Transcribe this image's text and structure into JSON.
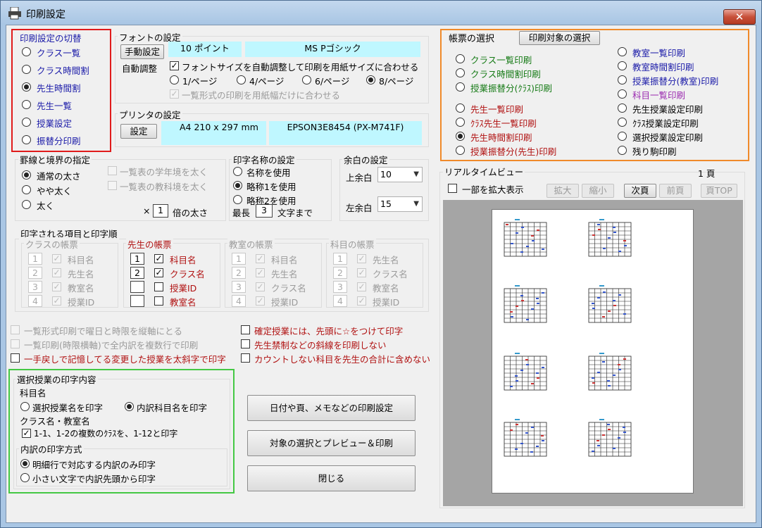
{
  "window": {
    "title": "印刷設定",
    "close": "✕"
  },
  "switch": {
    "title": "印刷設定の切替",
    "items": [
      "クラス一覧",
      "クラス時間割",
      "先生時間割",
      "先生一覧",
      "授業設定",
      "振替分印刷"
    ],
    "selected": 2
  },
  "font": {
    "title": "フォントの設定",
    "manual_button": "手動設定",
    "size": "10 ポイント",
    "name": "MS Pゴシック",
    "auto_label": "自動調整",
    "auto_check": "フォントサイズを自動調整して印刷を用紙サイズに合わせる",
    "pages": [
      "1/ページ",
      "4/ページ",
      "6/ページ",
      "8/ページ"
    ],
    "pages_selected": 3,
    "fit_width": "一覧形式の印刷を用紙幅だけに合わせる"
  },
  "printer": {
    "title": "プリンタの設定",
    "button": "設定",
    "paper": "A4 210 x 297 mm",
    "printer_name": "EPSON3E8454 (PX-M741F)"
  },
  "lines": {
    "title": "罫線と境界の指定",
    "options": [
      "通常の太さ",
      "やや太く",
      "太く"
    ],
    "selected": 0,
    "check1": "一覧表の学年境を太く",
    "check2": "一覧表の教科境を太く",
    "times_label": "×",
    "times_value": "1",
    "times_suffix": "倍の太さ"
  },
  "names": {
    "title": "印字名称の設定",
    "options": [
      "名称を使用",
      "略称1を使用",
      "略称2を使用"
    ],
    "selected": 1,
    "max_label": "最長",
    "max_value": "3",
    "max_suffix": "文字まで"
  },
  "margin": {
    "title": "余白の設定",
    "top_label": "上余白",
    "top_value": "10",
    "left_label": "左余白",
    "left_value": "15"
  },
  "items": {
    "title": "印字される項目と印字順",
    "class": {
      "title": "クラスの帳票",
      "rows": [
        {
          "n": "1",
          "label": "科目名"
        },
        {
          "n": "2",
          "label": "先生名"
        },
        {
          "n": "3",
          "label": "教室名"
        },
        {
          "n": "4",
          "label": "授業ID"
        }
      ]
    },
    "teacher": {
      "title": "先生の帳票",
      "rows": [
        {
          "n": "1",
          "label": "科目名"
        },
        {
          "n": "2",
          "label": "クラス名"
        },
        {
          "n": "",
          "label": "授業ID"
        },
        {
          "n": "",
          "label": "教室名"
        }
      ]
    },
    "room": {
      "title": "教室の帳票",
      "rows": [
        {
          "n": "1",
          "label": "科目名"
        },
        {
          "n": "2",
          "label": "先生名"
        },
        {
          "n": "3",
          "label": "クラス名"
        },
        {
          "n": "4",
          "label": "授業ID"
        }
      ]
    },
    "subject": {
      "title": "科目の帳票",
      "rows": [
        {
          "n": "1",
          "label": "先生名"
        },
        {
          "n": "2",
          "label": "クラス名"
        },
        {
          "n": "3",
          "label": "教室名"
        },
        {
          "n": "4",
          "label": "授業ID"
        }
      ]
    }
  },
  "opts_left": [
    "一覧形式印刷で曜日と時限を縦軸にとる",
    "一覧印刷(時限横軸)で全内訳を複数行で印刷",
    "一手戻しで記憶してる変更した授業を太斜字で印字"
  ],
  "opts_right": [
    "確定授業には、先頭に☆をつけて印字",
    "先生禁制などの斜線を印刷しない",
    "カウントしない科目を先生の合計に含めない"
  ],
  "selected_print": {
    "title": "選択授業の印字内容",
    "subject_label": "科目名",
    "opt1": "選択授業名を印字",
    "opt2": "内訳科目名を印字",
    "class_label": "クラス名・教室名",
    "class_check": "1-1、1-2の複数のｸﾗｽを、1-12と印字",
    "method_title": "内訳の印字方式",
    "m1": "明細行で対応する内訳のみ印字",
    "m2": "小さい文字で内訳先頭から印字"
  },
  "buttons": {
    "date": "日付や頁、メモなどの印刷設定",
    "preview": "対象の選択とプレビュー＆印刷",
    "close": "閉じる"
  },
  "report": {
    "title": "帳票の選択",
    "target_button": "印刷対象の選択",
    "left": [
      {
        "label": "クラス一覧印刷",
        "color": "green"
      },
      {
        "label": "クラス時間割印刷",
        "color": "green"
      },
      {
        "label": "授業振替分(ｸﾗｽ)印刷",
        "color": "green"
      },
      {
        "label": "先生一覧印刷",
        "color": "red"
      },
      {
        "label": "ｸﾗｽ先生一覧印刷",
        "color": "red"
      },
      {
        "label": "先生時間割印刷",
        "color": "red"
      },
      {
        "label": "授業振替分(先生)印刷",
        "color": "red"
      }
    ],
    "right": [
      {
        "label": "教室一覧印刷",
        "color": "blue"
      },
      {
        "label": "教室時間割印刷",
        "color": "blue"
      },
      {
        "label": "授業振替分(教室)印刷",
        "color": "blue"
      },
      {
        "label": "科目一覧印刷",
        "color": "purple"
      },
      {
        "label": "先生授業設定印刷",
        "color": "black"
      },
      {
        "label": "ｸﾗｽ授業設定印刷",
        "color": "black"
      },
      {
        "label": "選択授業設定印刷",
        "color": "black"
      },
      {
        "label": "残り駒印刷",
        "color": "black"
      }
    ],
    "selected": "left-5"
  },
  "realtime": {
    "title": "リアルタイムビュー",
    "page": "1 頁",
    "zoom_check": "一部を拡大表示",
    "zoom_in": "拡大",
    "zoom_out": "縮小",
    "next": "次頁",
    "prev": "前頁",
    "top": "頁TOP"
  }
}
